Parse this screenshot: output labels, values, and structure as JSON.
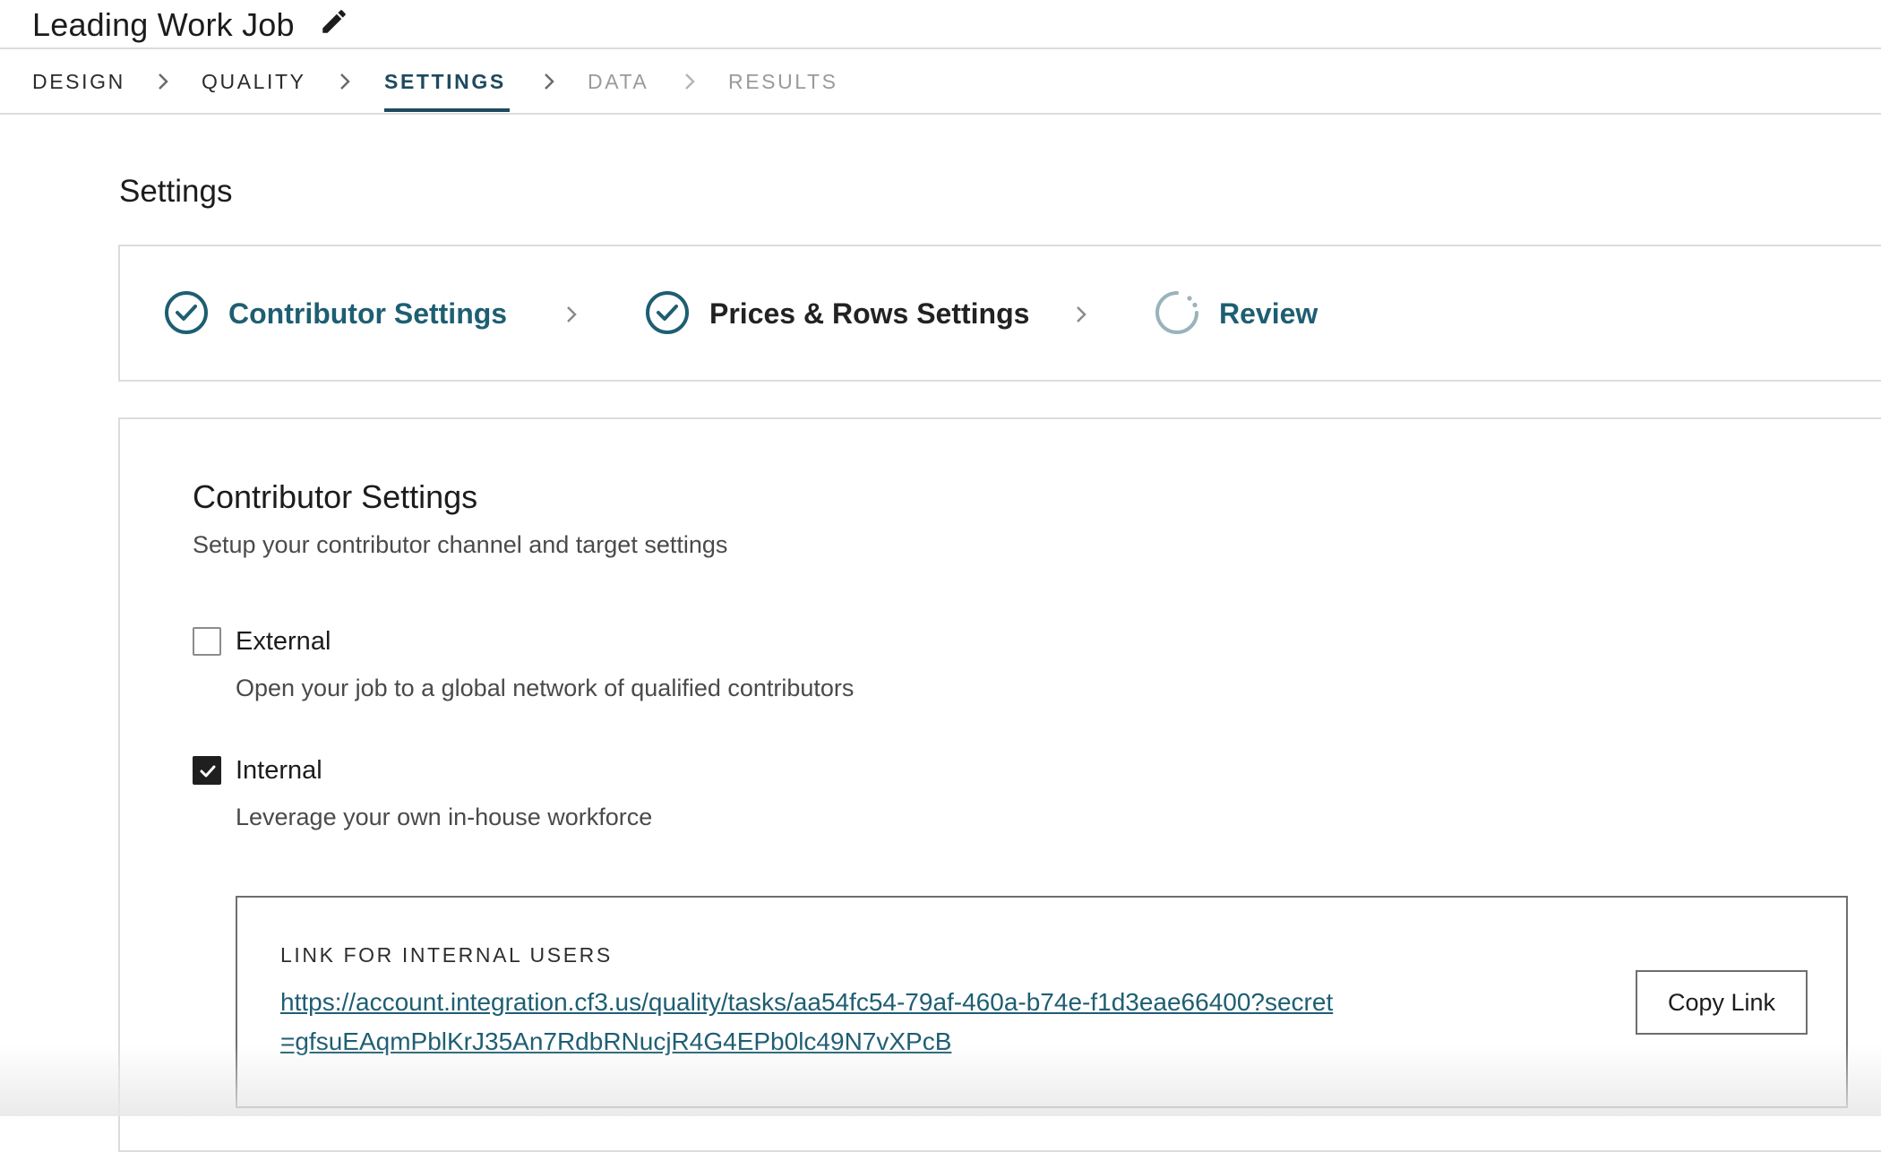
{
  "header": {
    "job_title": "Leading Work Job",
    "edit_icon": "pencil-icon"
  },
  "pipeline_nav": {
    "tabs": [
      {
        "label": "DESIGN",
        "state": "done"
      },
      {
        "label": "QUALITY",
        "state": "done"
      },
      {
        "label": "SETTINGS",
        "state": "active"
      },
      {
        "label": "DATA",
        "state": "disabled"
      },
      {
        "label": "RESULTS",
        "state": "disabled"
      }
    ]
  },
  "page": {
    "title": "Settings"
  },
  "stepper": {
    "steps": [
      {
        "label": "Contributor Settings",
        "icon": "check-circle-icon",
        "status": "complete"
      },
      {
        "label": "Prices & Rows Settings",
        "icon": "check-circle-icon",
        "status": "complete"
      },
      {
        "label": "Review",
        "icon": "spinner-icon",
        "status": "in-progress"
      }
    ]
  },
  "contributor_settings": {
    "title": "Contributor Settings",
    "subtitle": "Setup your contributor channel and target settings",
    "options": [
      {
        "label": "External",
        "description": "Open your job to a global network of qualified contributors",
        "checked": false
      },
      {
        "label": "Internal",
        "description": "Leverage your own in-house workforce",
        "checked": true
      }
    ],
    "internal_link": {
      "heading": "LINK FOR INTERNAL USERS",
      "url": "https://account.integration.cf3.us/quality/tasks/aa54fc54-79af-460a-b74e-f1d3eae66400?secret=gfsuEAqmPblKrJ35An7RdbRNucjR4G4EPb0lc49N7vXPcB",
      "copy_label": "Copy Link"
    }
  },
  "colors": {
    "accent": "#1e4a5e",
    "step_teal": "#1e5e72",
    "border": "#dcdcdc",
    "disabled_text": "#9a9a9a"
  }
}
